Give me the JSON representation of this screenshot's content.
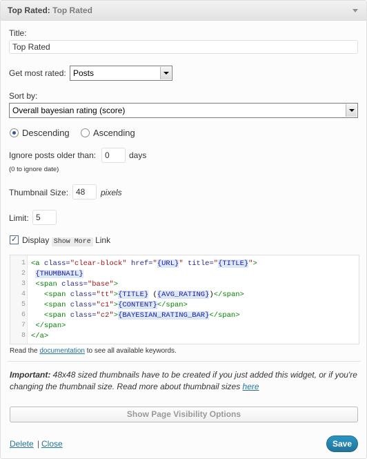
{
  "header": {
    "title": "Top Rated",
    "title_sep": ": ",
    "instance": "Top Rated"
  },
  "title_field": {
    "label": "Title:",
    "value": "Top Rated"
  },
  "get_most_rated": {
    "label": "Get most rated:",
    "selected": "Posts"
  },
  "sort_by": {
    "label": "Sort by:",
    "selected": "Overall bayesian rating (score)"
  },
  "order": {
    "descending": "Descending",
    "ascending": "Ascending",
    "checked": "descending"
  },
  "ignore_older": {
    "label": "Ignore posts older than:",
    "value": "0",
    "unit": "days",
    "hint": "(0 to ignore date)"
  },
  "thumbnail": {
    "label": "Thumbnail Size:",
    "value": "48",
    "unit": "pixels"
  },
  "limit": {
    "label": "Limit:",
    "value": "5"
  },
  "show_more": {
    "prefix": "Display",
    "code": "Show More",
    "suffix": "Link",
    "checked": true
  },
  "template_code": {
    "line_numbers": [
      "1",
      "2",
      "3",
      "4",
      "5",
      "6",
      "7",
      "8"
    ]
  },
  "doc_note": {
    "before": "Read the",
    "link": "documentation",
    "after": "to see all available keywords."
  },
  "important": {
    "label": "Important:",
    "text": "48x48 sized thumbnails have to be created if you just added this widget, or if you're changing the thumbnail size. Read more about thumbnail sizes",
    "link": "here"
  },
  "visibility_button": "Show Page Visibility Options",
  "footer": {
    "delete": "Delete",
    "separator": "|",
    "close": "Close",
    "save": "Save"
  },
  "colors": {
    "accent": "#21759b",
    "save_button": "#2a95c5"
  }
}
